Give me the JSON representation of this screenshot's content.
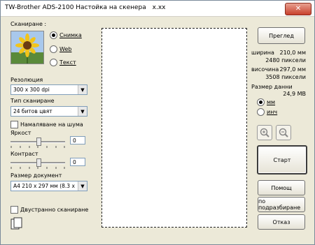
{
  "window": {
    "title": "TW-Brother ADS-2100 Настойка на скенера",
    "version": "x.xx",
    "close_label": "✕"
  },
  "scan": {
    "label": "Сканиране :",
    "options": [
      {
        "label": "Снимка",
        "selected": true
      },
      {
        "label": "Web",
        "selected": false
      },
      {
        "label": "Текст",
        "selected": false
      }
    ]
  },
  "resolution": {
    "label": "Резолюция",
    "value": "300 x 300 dpi"
  },
  "scan_type": {
    "label": "Тип сканиране",
    "value": "24 битов цвят"
  },
  "noise": {
    "label": "Намаляване на шума",
    "checked": false
  },
  "brightness": {
    "label": "Яркост",
    "value": "0",
    "level": 0.5
  },
  "contrast": {
    "label": "Контраст",
    "value": "0",
    "level": 0.5
  },
  "doc_size": {
    "label": "Размер документ",
    "value": "A4 210 x 297 мм (8.3 x 11.7"
  },
  "duplex": {
    "label": "Двустранно сканиране",
    "checked": false
  },
  "buttons": {
    "preview": "Преглед",
    "start": "Старт",
    "help": "Помощ",
    "default": "по подразбиране",
    "cancel": "Отказ"
  },
  "info": {
    "width_label": "ширина",
    "width_mm": "210,0 мм",
    "width_px": "2480 пиксели",
    "height_label": "височина",
    "height_mm": "297,0 мм",
    "height_px": "3508 пиксели",
    "data_size_label": "Размер данни",
    "data_size": "24,9 MB"
  },
  "units": {
    "options": [
      {
        "label": "мм",
        "selected": true
      },
      {
        "label": "инч",
        "selected": false
      }
    ]
  },
  "icons": {
    "zoom_in": "zoom-in-icon",
    "zoom_out": "zoom-out-icon",
    "document": "documents-icon",
    "photo": "sunflower-photo"
  }
}
